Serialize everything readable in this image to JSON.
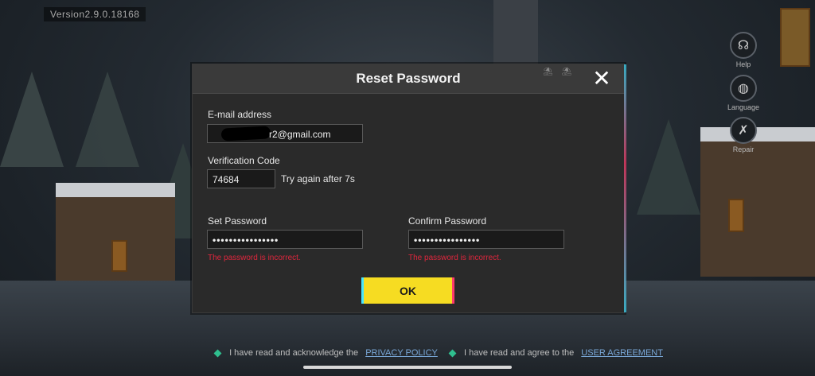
{
  "version": "Version2.9.0.18168",
  "side_buttons": [
    {
      "label": "Help",
      "icon": "help-headset-icon"
    },
    {
      "label": "Language",
      "icon": "globe-icon"
    },
    {
      "label": "Repair",
      "icon": "wrench-icon"
    }
  ],
  "dialog": {
    "title": "Reset Password",
    "close_symbol": "✕",
    "email": {
      "label": "E-mail address",
      "value": "r2@gmail.com"
    },
    "verification": {
      "label": "Verification Code",
      "value": "74684",
      "retry_text": "Try again after 7s"
    },
    "set_password": {
      "label": "Set Password",
      "value": "••••••••••••••••",
      "error": "The password is incorrect."
    },
    "confirm_password": {
      "label": "Confirm Password",
      "value": "••••••••••••••••",
      "error": "The password is incorrect."
    },
    "ok_label": "OK"
  },
  "footer": {
    "privacy_text": "I have read and acknowledge the",
    "privacy_link": "PRIVACY POLICY",
    "agreement_text": "I have read and agree to the",
    "agreement_link": "USER AGREEMENT"
  },
  "colors": {
    "accent_yellow": "#f6dc22",
    "error_red": "#e0263d",
    "check_green": "#2fbf8f"
  }
}
